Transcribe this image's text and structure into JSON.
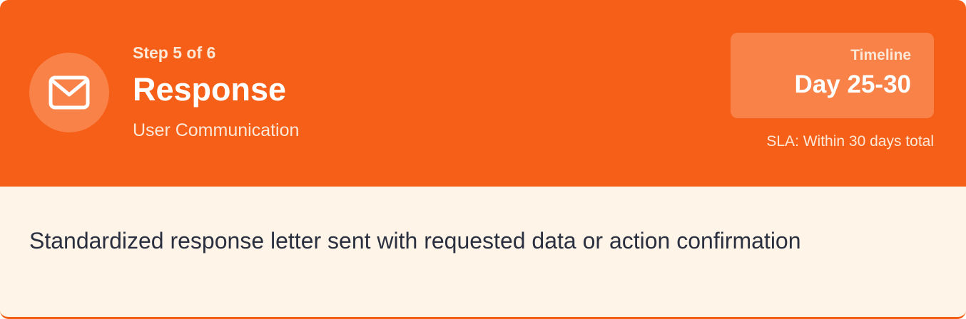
{
  "step": {
    "label": "Step 5 of 6",
    "title": "Response",
    "subtitle": "User Communication",
    "icon": "envelope-icon"
  },
  "timeline": {
    "label": "Timeline",
    "value": "Day 25-30",
    "sla": "SLA: Within 30 days total"
  },
  "description": "Standardized response letter sent with requested data or action confirmation",
  "colors": {
    "header_background": "#f65f17",
    "body_background": "#fef4e8",
    "accent_light": "#f98249",
    "text_dark": "#2a3040"
  }
}
